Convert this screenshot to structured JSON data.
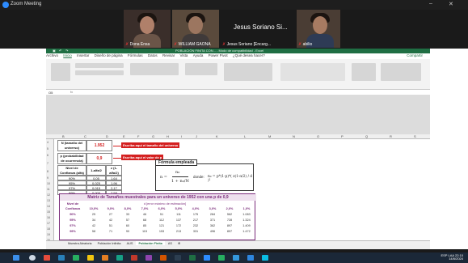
{
  "window": {
    "title": "Zoom Meeting",
    "minimize": "‒",
    "maximize": "▢",
    "close": "✕"
  },
  "participants": [
    {
      "name": "Dona Ensa"
    },
    {
      "name": "WILLIAM GAONA"
    },
    {
      "name": "Jesus Soriano [Encarg..."
    },
    {
      "name": "abilio"
    }
  ],
  "active_speaker": {
    "name": "Jesus Soriano Si..."
  },
  "excel": {
    "title": "POBLACIÓN FINITA CON...  - Modo de compatibilidad - Excel",
    "menu": [
      "Archivo",
      "Inicio",
      "Insertar",
      "Diseño de página",
      "Fórmulas",
      "Datos",
      "Revisar",
      "Vista",
      "Ayuda",
      "Power Pivot",
      "¿Qué desea hacer?"
    ],
    "share": "Compartir",
    "name_box": "O5",
    "columns": [
      "A",
      "B",
      "C",
      "D",
      "E",
      "F",
      "G",
      "H",
      "I",
      "J",
      "K",
      "L",
      "M",
      "N",
      "O",
      "P",
      "Q",
      "R",
      "S"
    ],
    "rows": [
      "4",
      "5",
      "6",
      "7",
      "8",
      "9",
      "10",
      "11",
      "12",
      "13",
      "14",
      "15",
      "16",
      "17",
      "18",
      "19",
      "20",
      "21",
      "22",
      "23"
    ],
    "universe_label": "N (tamaño del universo)",
    "universe_value": "1.952",
    "universe_hint": "Escriba aquí el tamaño del universo",
    "p_label": "p (probabilidad de ocurrencia)",
    "p_value": "0,9",
    "p_hint": "Escriba aquí el valor de p",
    "conf_headers": [
      "Nivel de Confianza (alfa)",
      "1-alfa/2",
      "z (1-alfa/2)"
    ],
    "conf_rows": [
      [
        "90%",
        "0,05",
        "1,64"
      ],
      [
        "95%",
        "0,025",
        "1,96"
      ],
      [
        "97%",
        "0,015",
        "2,17"
      ],
      [
        "99%",
        "0,005",
        "2,58"
      ]
    ],
    "formula_title": "Fórmula empleada",
    "formula_n": "n =",
    "formula_num": "n₀",
    "formula_den": "1 + n₀/N",
    "formula_donde": "donde:",
    "formula_n0": "n₀ = p*(1-p)*( z(1-α/2) / d )²",
    "matrix_title": "Matriz de Tamaños muestrales para un universo de 1952 con una p de 0,9",
    "matrix_corner": "Nivel de Confianza",
    "matrix_dhdr": "d [error máximo de estimación]",
    "matrix_d": [
      "10,0%",
      "9,0%",
      "8,0%",
      "7,0%",
      "6,0%",
      "5,0%",
      "4,0%",
      "3,0%",
      "2,0%",
      "1,0%"
    ],
    "matrix_rows": [
      {
        "conf": "90%",
        "vals": [
          "25",
          "27",
          "33",
          "46",
          "51",
          "111",
          "175",
          "284",
          "562",
          "1.083"
        ]
      },
      {
        "conf": "95%",
        "vals": [
          "34",
          "42",
          "57",
          "68",
          "112",
          "137",
          "217",
          "371",
          "728",
          "1.324"
        ]
      },
      {
        "conf": "97%",
        "vals": [
          "42",
          "51",
          "60",
          "85",
          "121",
          "172",
          "232",
          "362",
          "897",
          "1.409"
        ]
      },
      {
        "conf": "99%",
        "vals": [
          "58",
          "71",
          "90",
          "115",
          "153",
          "213",
          "331",
          "496",
          "897",
          "1.472"
        ]
      }
    ],
    "sheets": [
      "Muestra Aleatoria",
      "Población Infinita",
      "AUS",
      "Población Finita",
      "AS"
    ],
    "active_sheet": "Población Finita"
  },
  "taskbar": {
    "lang": "ESP LAA",
    "time": "22:10",
    "date": "14/6/2024"
  }
}
